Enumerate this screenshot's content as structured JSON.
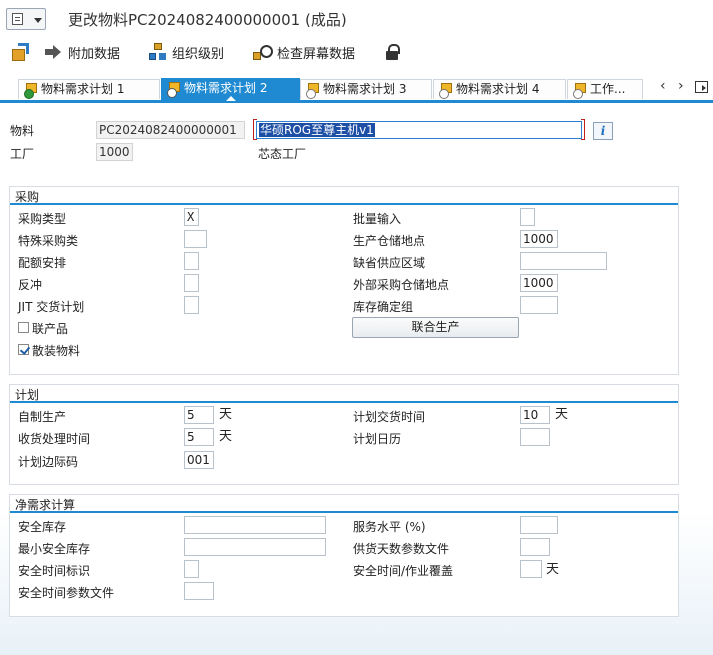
{
  "window": {
    "title": "更改物料PC2024082400000001 (成品)"
  },
  "toolbar": {
    "additional_data": "附加数据",
    "org_levels": "组织级别",
    "check_screen_data": "检查屏幕数据"
  },
  "tabs": [
    {
      "label": "物料需求计划 1",
      "state": "done"
    },
    {
      "label": "物料需求计划 2",
      "state": "active"
    },
    {
      "label": "物料需求计划 3",
      "state": "todo"
    },
    {
      "label": "物料需求计划 4",
      "state": "todo"
    },
    {
      "label": "工作...",
      "state": "todo"
    }
  ],
  "tab_nav": {
    "prev": "‹",
    "next": "›"
  },
  "header": {
    "material_label": "物料",
    "material_value": "PC2024082400000001",
    "description_value": "华硕ROG至尊主机v1",
    "plant_label": "工厂",
    "plant_value": "1000",
    "plant_name": "芯态工厂",
    "info_label": "i"
  },
  "procurement": {
    "title": "采购",
    "procurement_type_label": "采购类型",
    "procurement_type_value": "X",
    "special_procurement_label": "特殊采购类",
    "special_procurement_value": "",
    "quota_label": "配额安排",
    "quota_value": "",
    "backflush_label": "反冲",
    "backflush_value": "",
    "jit_label": "JIT 交货计划",
    "jit_value": "",
    "coproduct_label": "联产品",
    "coproduct_checked": false,
    "bulk_label": "散装物料",
    "bulk_checked": true,
    "batch_entry_label": "批量输入",
    "batch_entry_value": "",
    "prod_storage_label": "生产仓储地点",
    "prod_storage_value": "1000",
    "default_supply_area_label": "缺省供应区域",
    "default_supply_area_value": "",
    "ext_storage_label": "外部采购仓储地点",
    "ext_storage_value": "1000",
    "stock_det_group_label": "库存确定组",
    "stock_det_group_value": "",
    "joint_production_button": "联合生产"
  },
  "planning": {
    "title": "计划",
    "inhouse_label": "自制生产",
    "inhouse_value": "5",
    "inhouse_unit": "天",
    "gr_proc_label": "收货处理时间",
    "gr_proc_value": "5",
    "gr_proc_unit": "天",
    "sm_key_label": "计划边际码",
    "sm_key_value": "001",
    "planned_delivery_label": "计划交货时间",
    "planned_delivery_value": "10",
    "planned_delivery_unit": "天",
    "planning_calendar_label": "计划日历",
    "planning_calendar_value": ""
  },
  "net_requirements": {
    "title": "净需求计算",
    "safety_stock_label": "安全库存",
    "safety_stock_value": "",
    "min_safety_stock_label": "最小安全库存",
    "min_safety_stock_value": "",
    "safety_time_ind_label": "安全时间标识",
    "safety_time_ind_value": "",
    "safety_time_profile_label": "安全时间参数文件",
    "safety_time_profile_value": "",
    "service_level_label": "服务水平 (%)",
    "service_level_value": "",
    "cov_profile_label": "供货天数参数文件",
    "cov_profile_value": "",
    "safety_time_cov_label": "安全时间/作业覆盖",
    "safety_time_cov_value": "",
    "safety_time_cov_unit": "天"
  }
}
